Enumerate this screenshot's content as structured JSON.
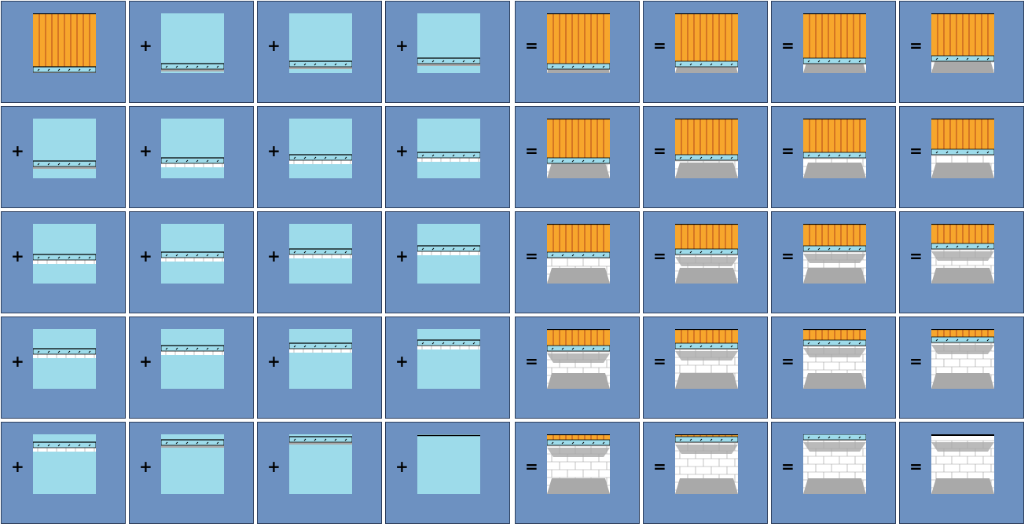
{
  "operators": {
    "plus": "+",
    "equals": "="
  },
  "colors": {
    "panel_bg": "#6d91c1",
    "panel_border": "#2d3f5e",
    "sky": "#9ddbea",
    "wall": "#f7a62c",
    "wall_stripe": "#b3471a",
    "floor": "#a9a9a9",
    "brick": "#ffffff",
    "brick_line": "#9a9a9a",
    "beam": "#000000"
  },
  "rows": [
    {
      "parts": [
        0,
        1,
        2,
        3
      ],
      "results": [
        1,
        2,
        3,
        4
      ]
    },
    {
      "parts": [
        4,
        5,
        6,
        7
      ],
      "results": [
        5,
        6,
        7,
        8
      ]
    },
    {
      "parts": [
        8,
        9,
        10,
        11
      ],
      "results": [
        9,
        10,
        11,
        12
      ]
    },
    {
      "parts": [
        12,
        13,
        14,
        15
      ],
      "results": [
        13,
        14,
        15,
        16
      ]
    },
    {
      "parts": [
        16,
        17,
        18,
        19
      ],
      "results": [
        17,
        18,
        19,
        20
      ]
    }
  ]
}
